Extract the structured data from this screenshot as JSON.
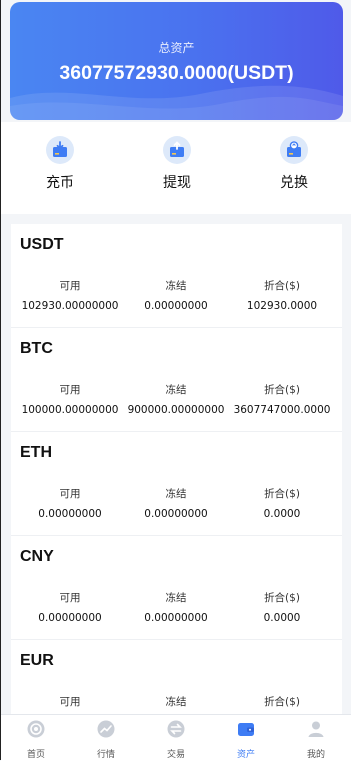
{
  "header": {
    "total_label": "总资产",
    "total_value": "36077572930.0000(USDT)"
  },
  "actions": [
    {
      "label": "充币",
      "icon": "deposit-icon"
    },
    {
      "label": "提现",
      "icon": "withdraw-icon"
    },
    {
      "label": "兑换",
      "icon": "exchange-icon"
    }
  ],
  "column_labels": {
    "available": "可用",
    "frozen": "冻结",
    "converted": "折合($)"
  },
  "assets": [
    {
      "name": "USDT",
      "available": "102930.00000000",
      "frozen": "0.00000000",
      "converted": "102930.0000"
    },
    {
      "name": "BTC",
      "available": "100000.00000000",
      "frozen": "900000.00000000",
      "converted": "3607747000.0000"
    },
    {
      "name": "ETH",
      "available": "0.00000000",
      "frozen": "0.00000000",
      "converted": "0.0000"
    },
    {
      "name": "CNY",
      "available": "0.00000000",
      "frozen": "0.00000000",
      "converted": "0.0000"
    },
    {
      "name": "EUR",
      "available": "",
      "frozen": "",
      "converted": ""
    }
  ],
  "tabs": [
    {
      "label": "首页",
      "icon": "home-icon"
    },
    {
      "label": "行情",
      "icon": "market-icon"
    },
    {
      "label": "交易",
      "icon": "trade-icon"
    },
    {
      "label": "资产",
      "icon": "wallet-icon",
      "active": true
    },
    {
      "label": "我的",
      "icon": "profile-icon"
    }
  ],
  "colors": {
    "accent": "#3e7cf4",
    "header_start": "#4a86f2",
    "header_end": "#4f5ae9"
  }
}
